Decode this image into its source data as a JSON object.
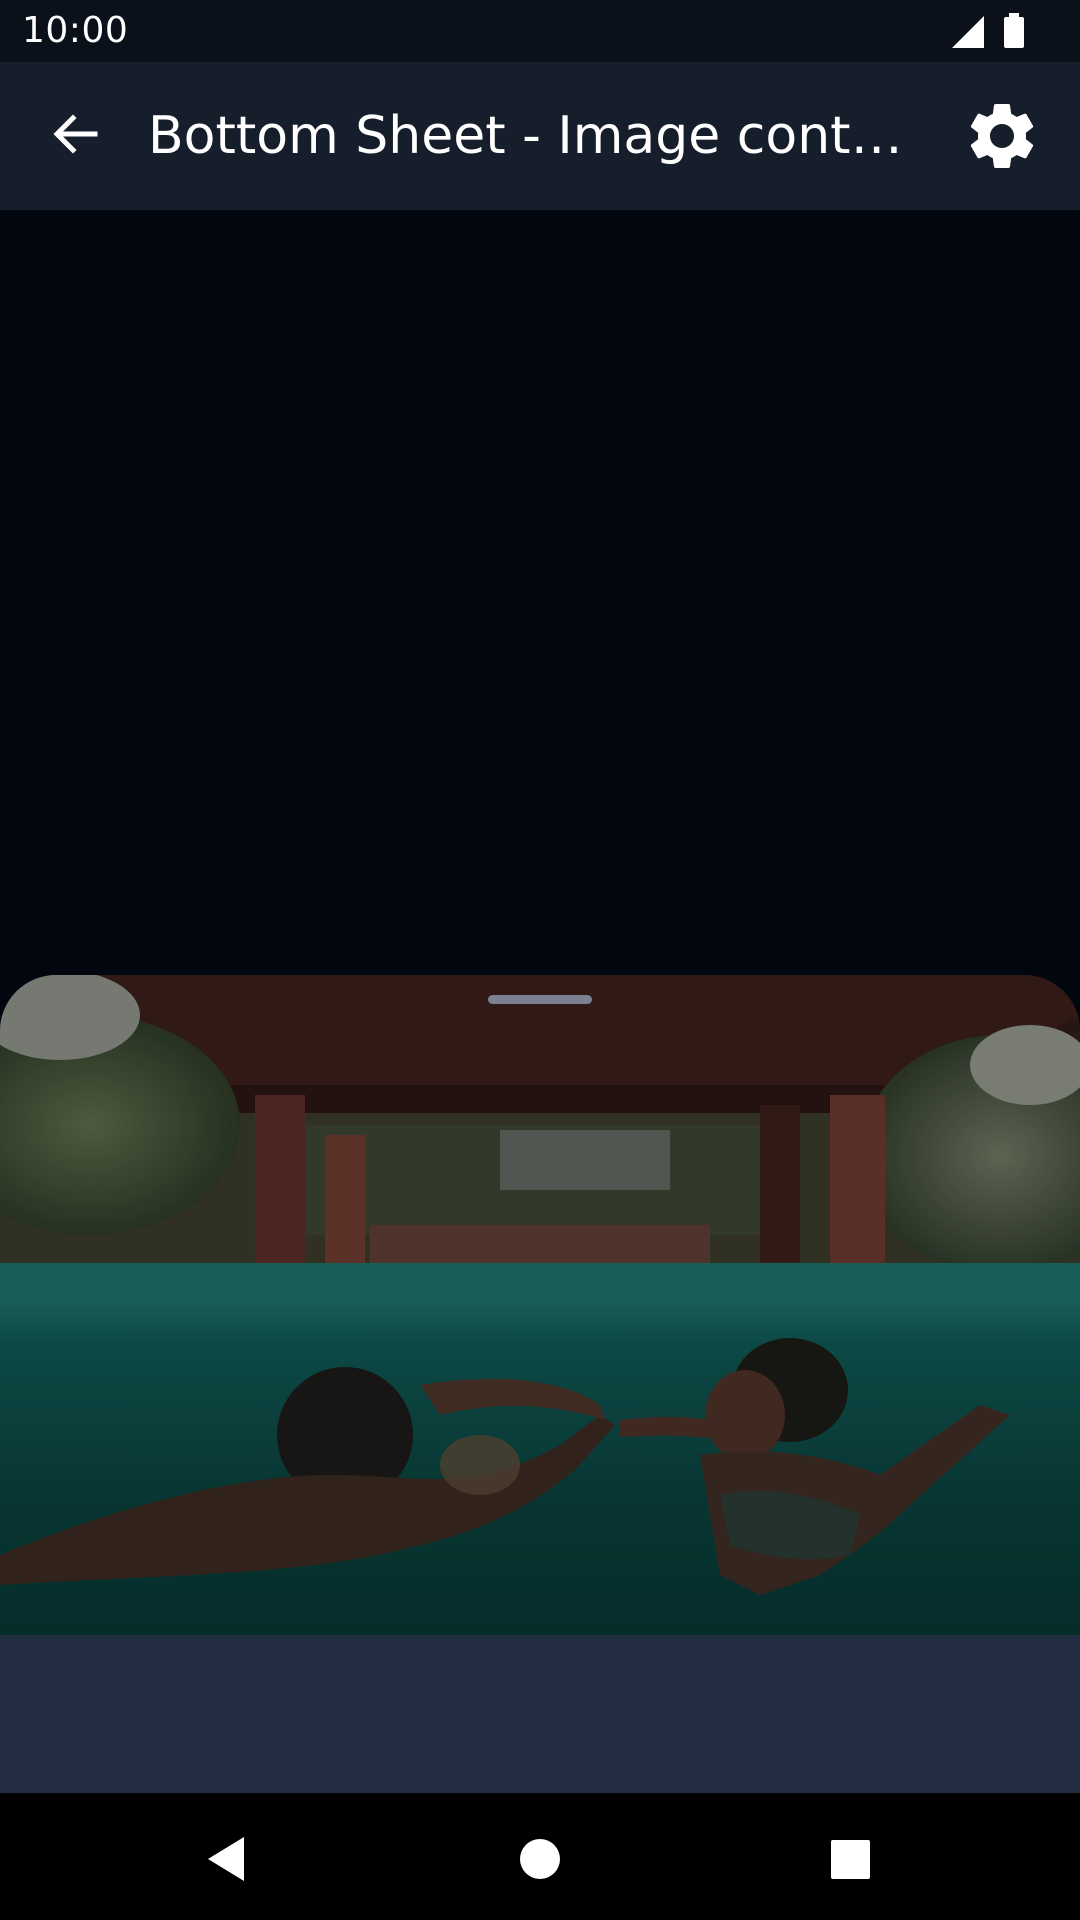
{
  "status_bar": {
    "time": "10:00",
    "icons": [
      "cellular-signal-icon",
      "battery-icon"
    ]
  },
  "app_bar": {
    "title": "Bottom Sheet - Image content",
    "back_icon": "arrow-back-icon",
    "settings_icon": "settings-gear-icon"
  },
  "bottom_sheet": {
    "image_description_icon": "underwater-photo",
    "handle": "drag-handle"
  },
  "nav_bar": {
    "buttons": [
      "back-triangle-icon",
      "home-circle-icon",
      "recents-square-icon"
    ]
  },
  "colors": {
    "status_bar": "#0b111b",
    "app_bar": "#171e2b",
    "scrim": "#02060f",
    "sheet": "#222d42",
    "nav_bar": "#000000"
  }
}
